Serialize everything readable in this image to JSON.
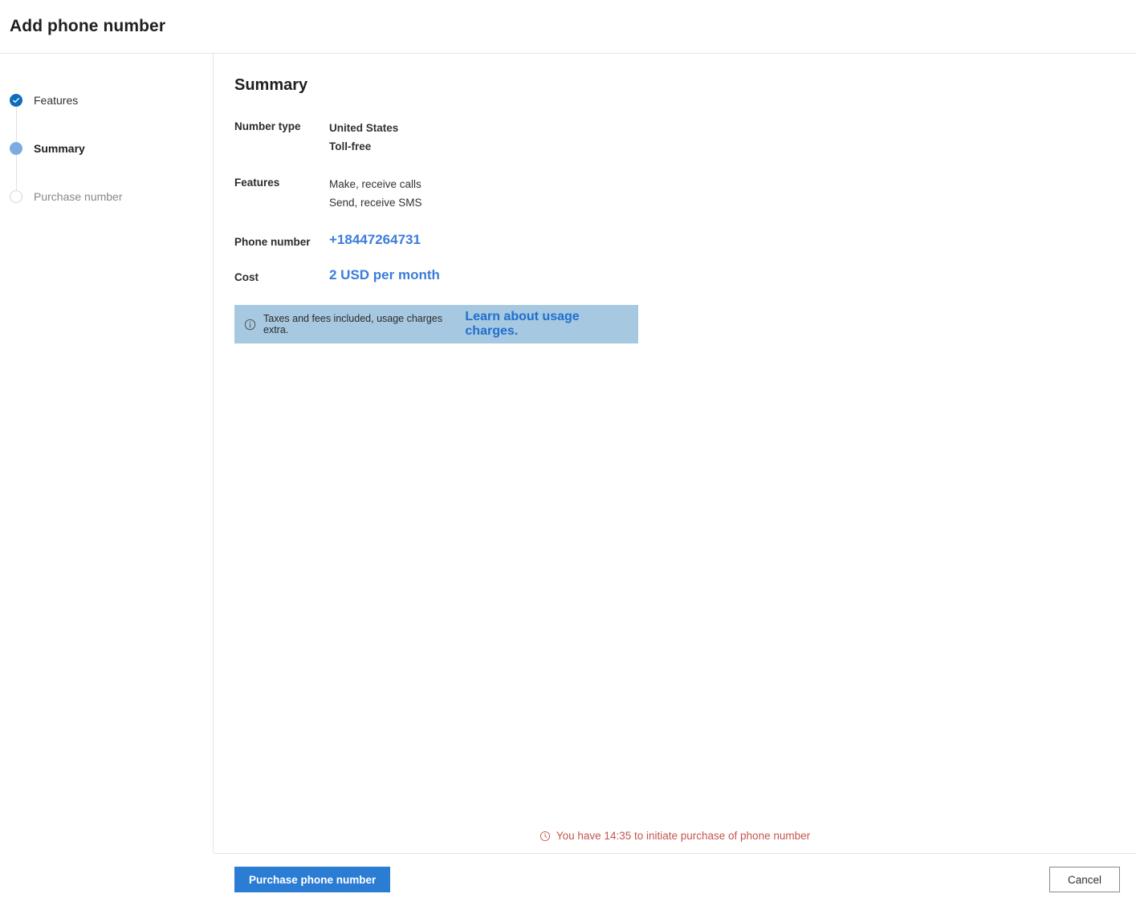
{
  "header": {
    "title": "Add phone number"
  },
  "stepper": {
    "steps": [
      {
        "label": "Features",
        "state": "done",
        "icon": "check-icon"
      },
      {
        "label": "Summary",
        "state": "current",
        "icon": "filled-circle-icon"
      },
      {
        "label": "Purchase number",
        "state": "todo",
        "icon": "empty-circle-icon"
      }
    ]
  },
  "summary": {
    "title": "Summary",
    "fields": [
      {
        "label": "Number type",
        "values": [
          "United States",
          "Toll-free"
        ],
        "style": "bold"
      },
      {
        "label": "Features",
        "values": [
          "Make, receive calls",
          "Send, receive SMS"
        ],
        "style": "normal"
      }
    ],
    "phone_number": {
      "label": "Phone number",
      "value": "+18447264731"
    },
    "cost": {
      "label": "Cost",
      "value": "2 USD per month"
    },
    "info_banner": {
      "icon": "info-circle-icon",
      "text": "Taxes and fees included, usage charges extra.",
      "link_text": "Learn about usage charges."
    }
  },
  "timer": {
    "icon": "clock-icon",
    "text": "You have 14:35 to initiate purchase of phone number",
    "remaining": "14:35"
  },
  "footer": {
    "primary_label": "Purchase phone number",
    "cancel_label": "Cancel"
  },
  "colors": {
    "accent": "#2b7cd3",
    "step_done": "#0f6cbd",
    "step_current": "#7cabe3",
    "link": "#3b7dd8",
    "banner_bg": "#a6c8e0",
    "banner_link": "#1f6fd0",
    "timer_text": "#c4554d"
  }
}
